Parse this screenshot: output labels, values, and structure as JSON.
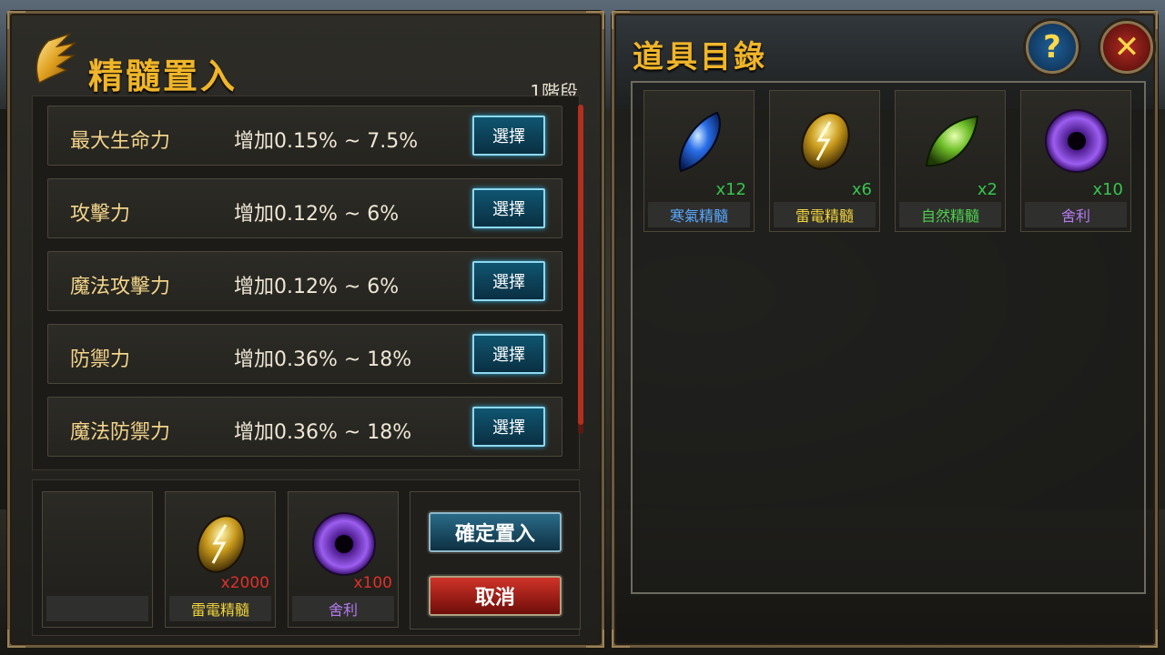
{
  "left_panel": {
    "title": "精髓置入",
    "stage": "1階段",
    "stats": [
      {
        "name": "最大生命力",
        "desc": "增加0.15% ~ 7.5%",
        "button": "選擇"
      },
      {
        "name": "攻擊力",
        "desc": "增加0.12% ~ 6%",
        "button": "選擇"
      },
      {
        "name": "魔法攻擊力",
        "desc": "增加0.12% ~ 6%",
        "button": "選擇"
      },
      {
        "name": "防禦力",
        "desc": "增加0.36% ~ 18%",
        "button": "選擇"
      },
      {
        "name": "魔法防禦力",
        "desc": "增加0.36% ~ 18%",
        "button": "選擇"
      }
    ],
    "slots": [
      {
        "label": "",
        "qty": ""
      },
      {
        "label": "雷電精髓",
        "qty": "x2000",
        "label_color": "#f2d53c"
      },
      {
        "label": "舍利",
        "qty": "x100",
        "label_color": "#b57bf0"
      }
    ],
    "confirm_label": "確定置入",
    "cancel_label": "取消"
  },
  "right_panel": {
    "title": "道具目錄",
    "help_icon": "?",
    "close_icon": "✕",
    "items": [
      {
        "label": "寒氣精髓",
        "qty": "x12",
        "label_color": "#5aa8ff",
        "icon": "ice-essence-icon"
      },
      {
        "label": "雷電精髓",
        "qty": "x6",
        "label_color": "#f2d53c",
        "icon": "lightning-essence-icon"
      },
      {
        "label": "自然精髓",
        "qty": "x2",
        "label_color": "#4ed04e",
        "icon": "nature-essence-icon"
      },
      {
        "label": "舍利",
        "qty": "x10",
        "label_color": "#b57bf0",
        "icon": "sarira-icon"
      }
    ]
  },
  "colors": {
    "title": "#f0b52a",
    "qty_red": "#e0302a",
    "qty_green": "#36c44e",
    "select_button": "#0f5570"
  }
}
